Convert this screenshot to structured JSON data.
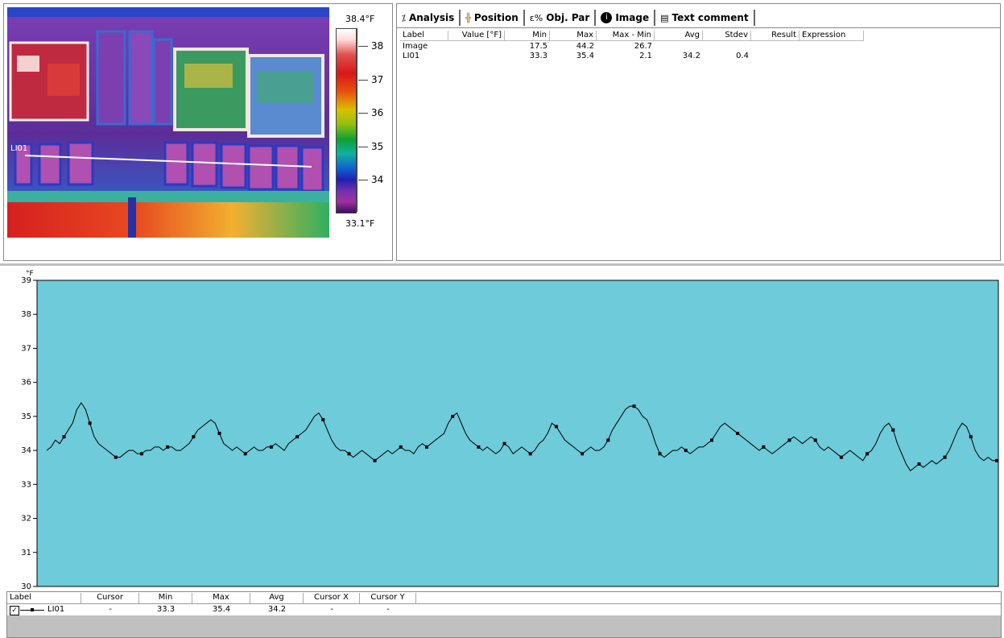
{
  "thermal": {
    "scale_max": "38.4°F",
    "scale_min": "33.1°F",
    "ticks": [
      "38",
      "37",
      "36",
      "35",
      "34"
    ],
    "line_label": "LI01"
  },
  "tabs": [
    {
      "icon": "analysis-icon",
      "label": "Analysis"
    },
    {
      "icon": "position-icon",
      "label": "Position"
    },
    {
      "icon": "obj-par-icon",
      "label": "Obj. Par"
    },
    {
      "icon": "info-icon",
      "label": "Image"
    },
    {
      "icon": "text-comment-icon",
      "label": "Text comment"
    }
  ],
  "analysis_table": {
    "headers": [
      "Label",
      "Value [°F]",
      "Min",
      "Max",
      "Max - Min",
      "Avg",
      "Stdev",
      "Result",
      "Expression"
    ],
    "rows": [
      {
        "label": "Image",
        "value": "",
        "min": "17.5",
        "max": "44.2",
        "maxmin": "26.7",
        "avg": "",
        "stdev": ""
      },
      {
        "label": "LI01",
        "value": "",
        "min": "33.3",
        "max": "35.4",
        "maxmin": "2.1",
        "avg": "34.2",
        "stdev": "0.4"
      }
    ]
  },
  "chart_data": {
    "type": "line",
    "ylabel": "°F",
    "ylim": [
      30,
      39
    ],
    "yticks": [
      "39",
      "38",
      "37",
      "36",
      "35",
      "34",
      "33",
      "32",
      "31",
      "30"
    ],
    "background": "#6ecbd9",
    "series": [
      {
        "name": "LI01",
        "values": [
          34.0,
          34.1,
          34.3,
          34.2,
          34.4,
          34.6,
          34.8,
          35.2,
          35.4,
          35.2,
          34.8,
          34.4,
          34.2,
          34.1,
          34.0,
          33.9,
          33.8,
          33.8,
          33.9,
          34.0,
          34.0,
          33.9,
          33.9,
          34.0,
          34.0,
          34.1,
          34.1,
          34.0,
          34.1,
          34.1,
          34.0,
          34.0,
          34.1,
          34.2,
          34.4,
          34.6,
          34.7,
          34.8,
          34.9,
          34.8,
          34.5,
          34.2,
          34.1,
          34.0,
          34.1,
          34.0,
          33.9,
          34.0,
          34.1,
          34.0,
          34.0,
          34.1,
          34.1,
          34.2,
          34.1,
          34.0,
          34.2,
          34.3,
          34.4,
          34.5,
          34.6,
          34.8,
          35.0,
          35.1,
          34.9,
          34.6,
          34.3,
          34.1,
          34.0,
          34.0,
          33.9,
          33.8,
          33.9,
          34.0,
          33.9,
          33.8,
          33.7,
          33.8,
          33.9,
          34.0,
          33.9,
          34.0,
          34.1,
          34.0,
          34.0,
          33.9,
          34.1,
          34.2,
          34.1,
          34.2,
          34.3,
          34.4,
          34.5,
          34.8,
          35.0,
          35.1,
          34.8,
          34.5,
          34.3,
          34.2,
          34.1,
          34.0,
          34.1,
          34.0,
          33.9,
          34.0,
          34.2,
          34.1,
          33.9,
          34.0,
          34.1,
          34.0,
          33.9,
          34.0,
          34.2,
          34.3,
          34.5,
          34.8,
          34.7,
          34.5,
          34.3,
          34.2,
          34.1,
          34.0,
          33.9,
          34.0,
          34.1,
          34.0,
          34.0,
          34.1,
          34.3,
          34.6,
          34.8,
          35.0,
          35.2,
          35.3,
          35.3,
          35.2,
          35.0,
          34.9,
          34.6,
          34.2,
          33.9,
          33.8,
          33.9,
          34.0,
          34.0,
          34.1,
          34.0,
          33.9,
          34.0,
          34.1,
          34.1,
          34.2,
          34.3,
          34.5,
          34.7,
          34.8,
          34.7,
          34.6,
          34.5,
          34.4,
          34.3,
          34.2,
          34.1,
          34.0,
          34.1,
          34.0,
          33.9,
          34.0,
          34.1,
          34.2,
          34.3,
          34.4,
          34.3,
          34.2,
          34.3,
          34.4,
          34.3,
          34.1,
          34.0,
          34.1,
          34.0,
          33.9,
          33.8,
          33.9,
          34.0,
          33.9,
          33.8,
          33.7,
          33.9,
          34.0,
          34.2,
          34.5,
          34.7,
          34.8,
          34.6,
          34.2,
          33.9,
          33.6,
          33.4,
          33.5,
          33.6,
          33.5,
          33.6,
          33.7,
          33.6,
          33.7,
          33.8,
          34.0,
          34.3,
          34.6,
          34.8,
          34.7,
          34.4,
          34.0,
          33.8,
          33.7,
          33.8,
          33.7,
          33.7
        ]
      }
    ]
  },
  "legend_table": {
    "headers": [
      "Label",
      "Cursor",
      "Min",
      "Max",
      "Avg",
      "Cursor X",
      "Cursor Y"
    ],
    "row": {
      "checkbox": "checked",
      "label": "LI01",
      "cursor": "-",
      "min": "33.3",
      "max": "35.4",
      "avg": "34.2",
      "cursor_x": "-",
      "cursor_y": "-"
    }
  }
}
